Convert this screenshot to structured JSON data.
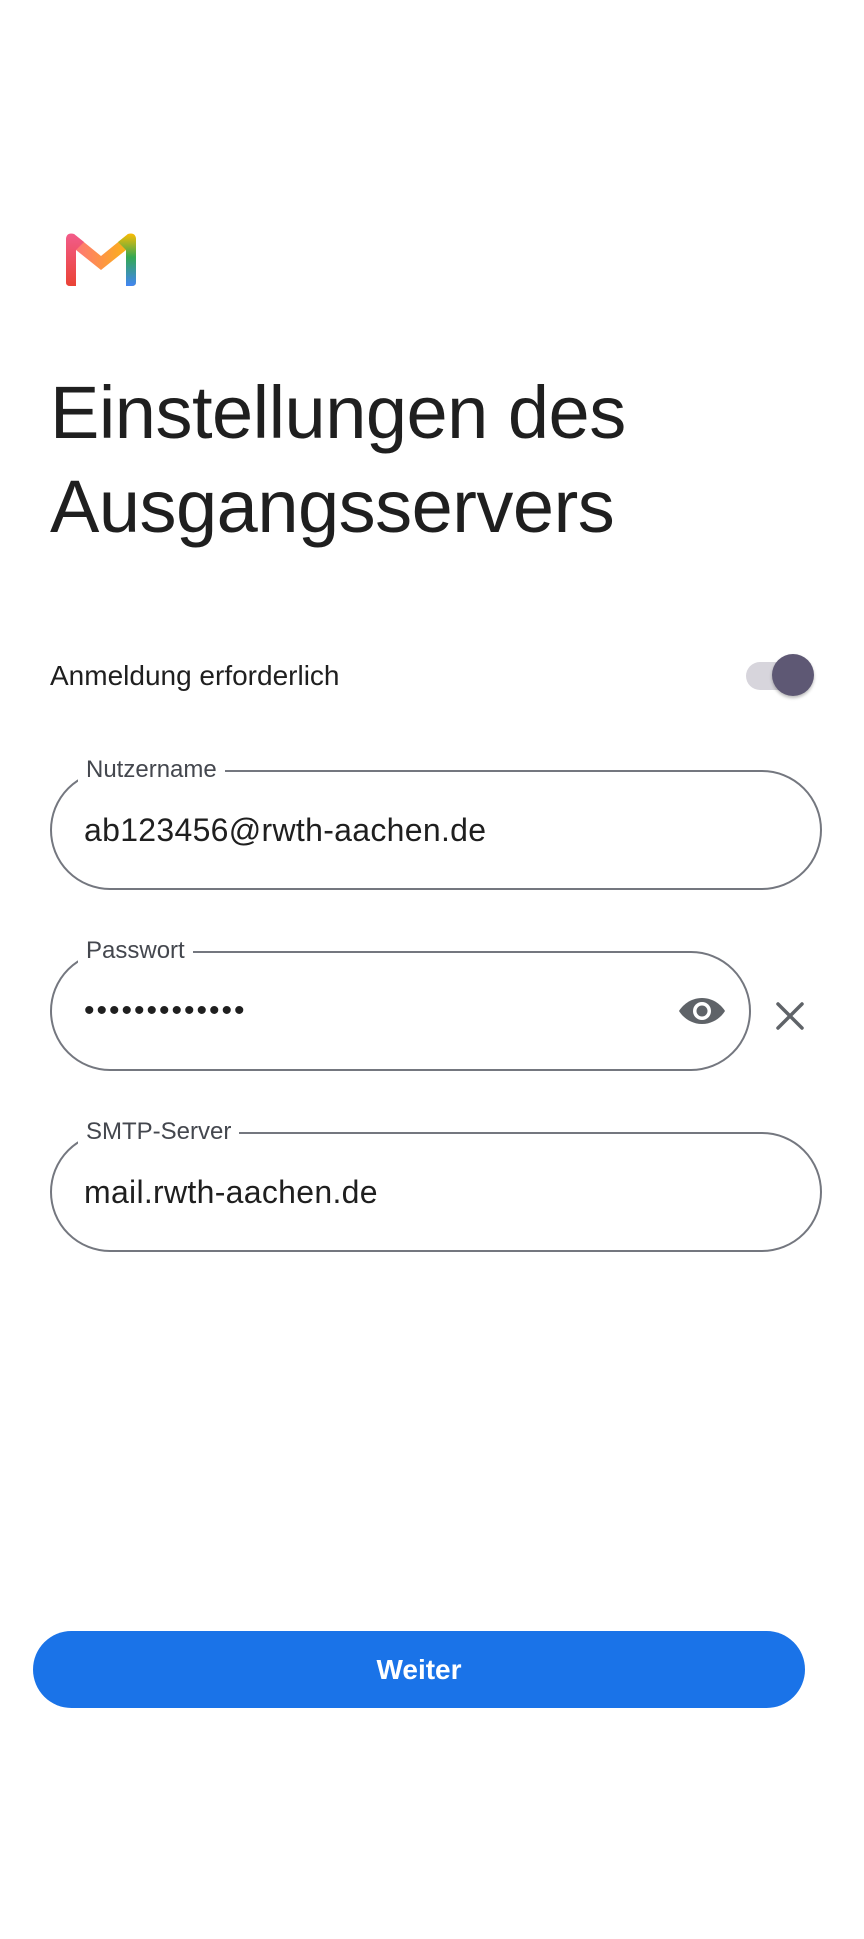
{
  "app": {
    "logo": "gmail-logo"
  },
  "header": {
    "title_line1": "Einstellungen des",
    "title_line2": "Ausgangsservers"
  },
  "auth_required": {
    "label": "Anmeldung erforderlich",
    "enabled": true
  },
  "fields": {
    "username": {
      "label": "Nutzername",
      "value": "ab123456@rwth-aachen.de"
    },
    "password": {
      "label": "Passwort",
      "value": "•••••••••••••",
      "reveal_icon": "eye-icon",
      "clear_icon": "close-icon"
    },
    "smtp_server": {
      "label": "SMTP-Server",
      "value": "mail.rwth-aachen.de"
    }
  },
  "actions": {
    "next_label": "Weiter"
  },
  "colors": {
    "primary": "#1a73e8",
    "switch_thumb": "#5e5874",
    "switch_track": "#d7d5dc",
    "outline": "#74777f"
  }
}
